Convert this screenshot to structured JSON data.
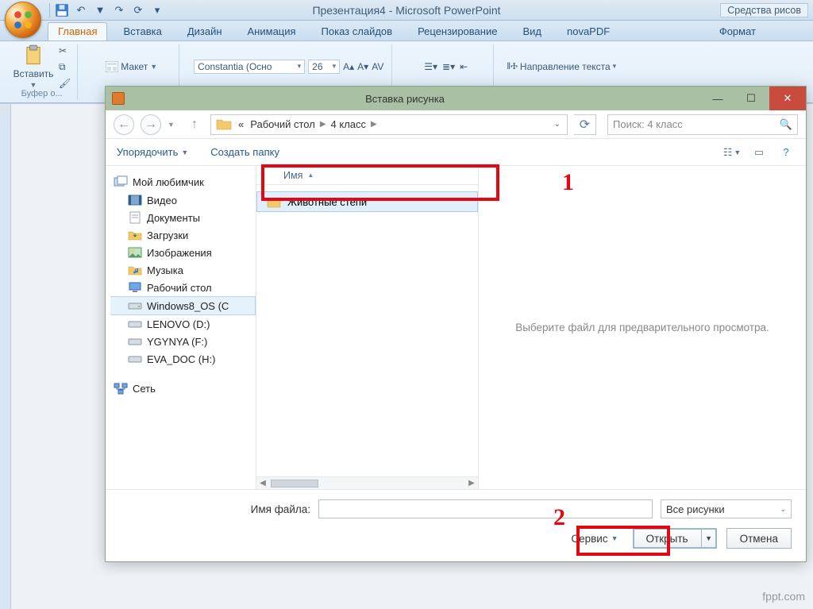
{
  "app": {
    "title": "Презентация4 - Microsoft PowerPoint",
    "drawing_tools": "Средства рисов"
  },
  "qat": {
    "save": "save-icon",
    "undo": "undo-icon",
    "redo": "redo-icon",
    "repeat": "repeat-icon"
  },
  "ribbon": {
    "tabs": [
      "Главная",
      "Вставка",
      "Дизайн",
      "Анимация",
      "Показ слайдов",
      "Рецензирование",
      "Вид",
      "novaPDF"
    ],
    "tab_format": "Формат",
    "paste": "Вставить",
    "clipboard_label": "Буфер о...",
    "layout": "Макет",
    "font_name": "Constantia (Осно",
    "font_size": "26",
    "text_direction": "Направление текста"
  },
  "dialog": {
    "title": "Вставка рисунка",
    "nav_back": "back",
    "nav_fwd": "forward",
    "nav_up": "up",
    "breadcrumbs": [
      "Рабочий стол",
      "4 класс"
    ],
    "refresh": "refresh",
    "search_placeholder": "Поиск: 4 класс",
    "organize": "Упорядочить",
    "new_folder": "Создать папку",
    "column_name": "Имя",
    "tree": {
      "favorites_label": "Мой любимчик",
      "favorites": [
        "Видео",
        "Документы",
        "Загрузки",
        "Изображения",
        "Музыка",
        "Рабочий стол",
        "Windows8_OS (C",
        "LENOVO (D:)",
        "YGYNYA (F:)",
        "EVA_DOC (H:)"
      ],
      "network_label": "Сеть"
    },
    "rows": [
      {
        "name": "Животные степи",
        "type": "folder",
        "selected": true
      }
    ],
    "preview_hint": "Выберите файл для предварительного просмотра.",
    "filename_label": "Имя файла:",
    "filename_value": "",
    "filter": "Все рисунки",
    "tools": "Сервис",
    "open": "Открыть",
    "cancel": "Отмена"
  },
  "annotations": {
    "one": "1",
    "two": "2"
  },
  "watermark": "fppt.com"
}
